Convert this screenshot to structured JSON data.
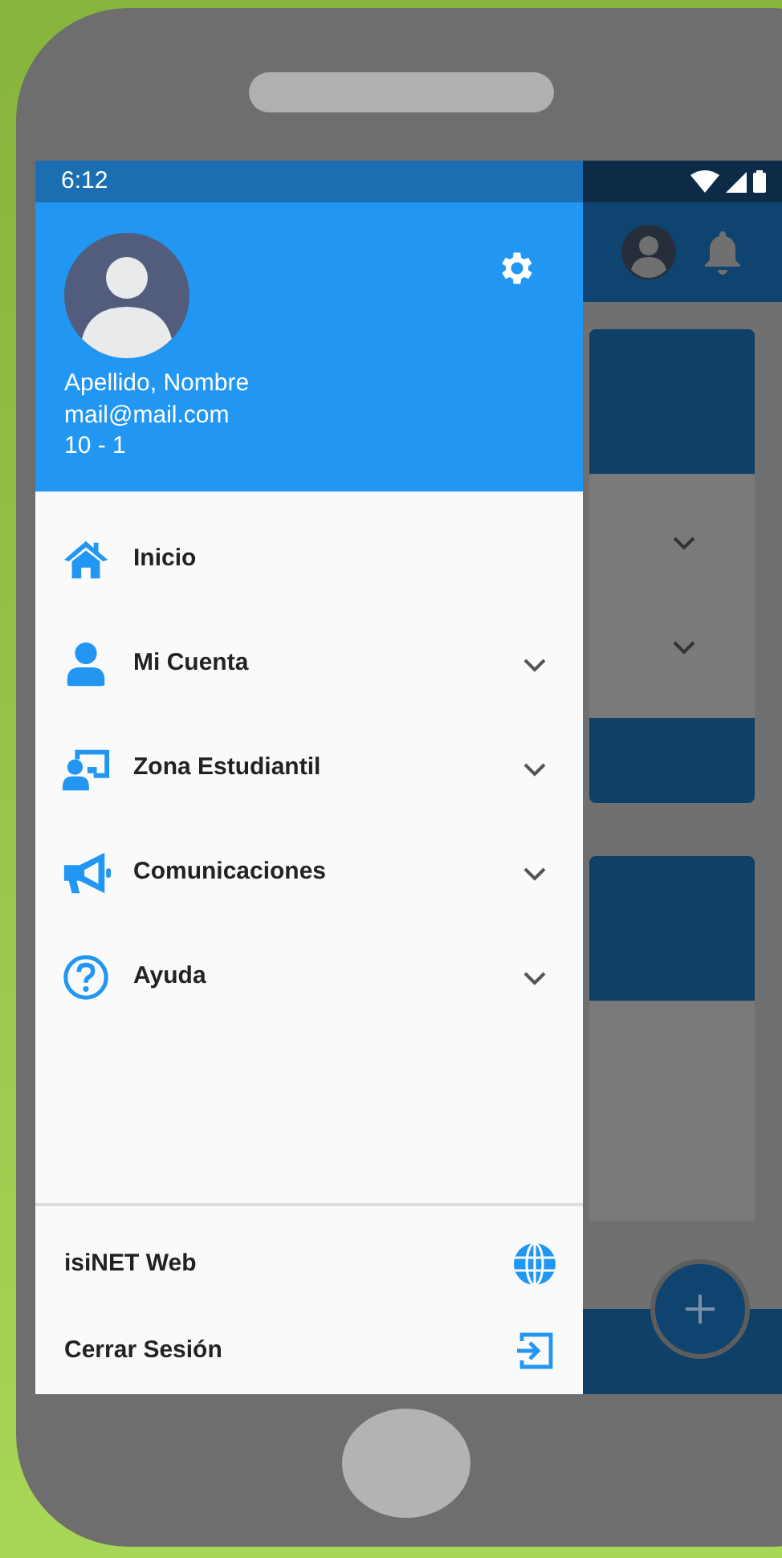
{
  "status_bar": {
    "time": "6:12"
  },
  "drawer_header": {
    "name": "Apellido, Nombre",
    "email": "mail@mail.com",
    "course": "10 - 1"
  },
  "menu": {
    "items": [
      {
        "label": "Inicio",
        "expandable": false
      },
      {
        "label": "Mi Cuenta",
        "expandable": true
      },
      {
        "label": "Zona Estudiantil",
        "expandable": true
      },
      {
        "label": "Comunicaciones",
        "expandable": true
      },
      {
        "label": "Ayuda",
        "expandable": true
      }
    ]
  },
  "footer_items": [
    {
      "label": "isiNET Web"
    },
    {
      "label": "Cerrar Sesión"
    }
  ]
}
